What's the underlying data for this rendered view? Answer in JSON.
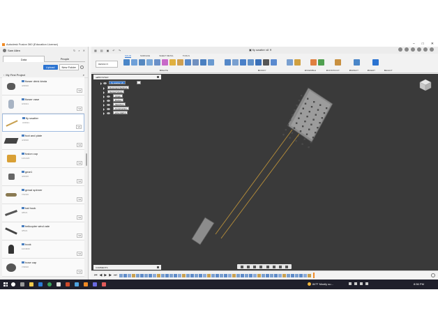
{
  "app": {
    "title": "Autodesk Fusion 360 (Education License)"
  },
  "user": {
    "name": "Sam Allen"
  },
  "data_panel": {
    "tabs": [
      "Data",
      "People"
    ],
    "upload_label": "Upload",
    "new_folder_label": "New Folder",
    "project": "My First Project",
    "items": [
      {
        "name": "flower drink kinda",
        "date": "4/28/20",
        "version": "V1"
      },
      {
        "name": "flower vase",
        "date": "3/19/21",
        "version": "V1"
      },
      {
        "name": "fly swatter",
        "date": "3/18/21",
        "version": "V1"
      },
      {
        "name": "foot and plate",
        "date": "4/18/20",
        "version": "V1"
      },
      {
        "name": "fusion cup",
        "date": "11/11/20",
        "version": "V1"
      },
      {
        "name": "gear1",
        "date": "4/20/20",
        "version": "V1"
      },
      {
        "name": "gread spinner",
        "date": "7/22/20",
        "version": "V1"
      },
      {
        "name": "hat hook",
        "date": "3/8/21",
        "version": "V1"
      },
      {
        "name": "helicopter wind vale",
        "date": "3/5/21",
        "version": "V1"
      },
      {
        "name": "hook",
        "date": "10/18/20",
        "version": "V1"
      },
      {
        "name": "hose cap",
        "date": "7/28/20",
        "version": "V1"
      }
    ]
  },
  "toolbar": {
    "document_name": "fly swatter v8",
    "workspace": "DESIGN",
    "ribbon_tabs": [
      "SOLID",
      "SURFACE",
      "SHEET METAL",
      "TOOLS"
    ],
    "groups": [
      "CREATE",
      "MODIFY",
      "ASSEMBLE",
      "CONSTRUCT",
      "INSPECT",
      "INSERT",
      "SELECT"
    ]
  },
  "browser": {
    "title": "BROWSER",
    "root": "fly swatter v8",
    "nodes": [
      "Document Settings",
      "Named Views",
      "Origin",
      "Bodies",
      "Sketches",
      "Construction",
      "wire shaft:1"
    ]
  },
  "comments": {
    "title": "COMMENTS"
  },
  "taskbar": {
    "weather": "84°F  Mostly su...",
    "time": "8:56 PM"
  }
}
